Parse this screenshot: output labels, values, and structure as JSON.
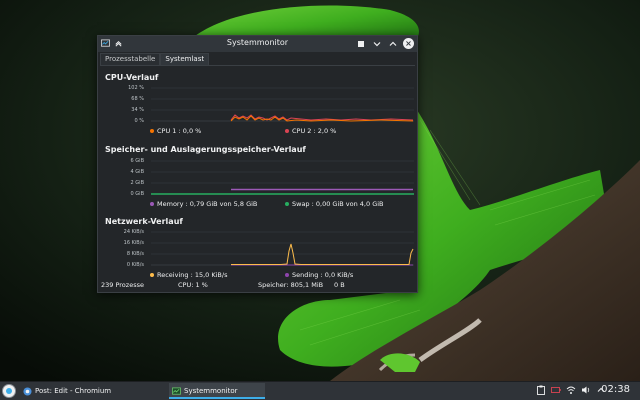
{
  "window": {
    "title": "Systemmonitor",
    "tabs": [
      {
        "label": "Prozesstabelle",
        "active": false
      },
      {
        "label": "Systemlast",
        "active": true
      }
    ]
  },
  "cpu": {
    "title": "CPU-Verlauf",
    "axis_labels": [
      "102 %",
      "68 %",
      "34 %",
      "0 %"
    ],
    "legend": [
      {
        "label": "CPU 1 : 0,0 %",
        "color": "#f67400"
      },
      {
        "label": "CPU 2 : 2,0 %",
        "color": "#da4453"
      }
    ]
  },
  "memory": {
    "title": "Speicher- und Auslagerungsspeicher-Verlauf",
    "axis_labels": [
      "6 GiB",
      "4 GiB",
      "2 GiB",
      "0 GiB"
    ],
    "legend": [
      {
        "label": "Memory : 0,79 GiB von 5,8 GiB",
        "color": "#9b59b6"
      },
      {
        "label": "Swap : 0,00 GiB von 4,0 GiB",
        "color": "#27ae60"
      }
    ]
  },
  "network": {
    "title": "Netzwerk-Verlauf",
    "axis_labels": [
      "24 KiB/s",
      "16 KiB/s",
      "8 KiB/s",
      "0 KiB/s"
    ],
    "legend": [
      {
        "label": "Receiving : 15,0 KiB/s",
        "color": "#fdbc4b"
      },
      {
        "label": "Sending : 0,0 KiB/s",
        "color": "#8e44ad"
      }
    ]
  },
  "status": {
    "processes": "239 Prozesse",
    "cpu": "CPU: 1 %",
    "memory": "Speicher: 805,1 MiB",
    "swap": "0 B"
  },
  "taskbar": {
    "tasks": [
      {
        "label": "Post: Edit - Chromium",
        "active": false
      },
      {
        "label": "Systemmonitor",
        "active": true
      }
    ],
    "clock": "02:38"
  },
  "icons": {
    "launcher": "application-launcher-icon",
    "chromium": "chromium-icon",
    "sysmon": "system-monitor-icon",
    "tray": [
      "clipboard-icon",
      "battery-icon",
      "network-icon",
      "volume-icon",
      "expand-tray-icon"
    ]
  }
}
